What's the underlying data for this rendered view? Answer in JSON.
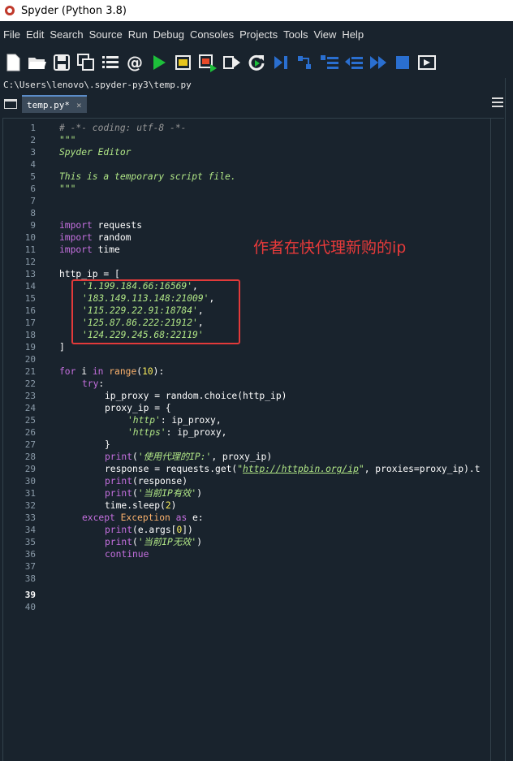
{
  "window": {
    "title": "Spyder (Python 3.8)"
  },
  "menu": [
    "File",
    "Edit",
    "Search",
    "Source",
    "Run",
    "Debug",
    "Consoles",
    "Projects",
    "Tools",
    "View",
    "Help"
  ],
  "toolbar_icons": [
    "new-file-icon",
    "open-folder-icon",
    "save-icon",
    "save-all-icon",
    "outline-icon",
    "at-icon",
    "run-icon",
    "run-cell-icon",
    "run-cell-advance-icon",
    "run-selection-icon",
    "re-run-icon",
    "debug-icon",
    "step-icon",
    "step-into-icon",
    "step-return-icon",
    "continue-icon",
    "stop-icon",
    "maximize-pane-icon"
  ],
  "path": "C:\\Users\\lenovo\\.spyder-py3\\temp.py",
  "tab": {
    "label": "temp.py*",
    "close": "×"
  },
  "line_numbers": [
    "1",
    "2",
    "3",
    "4",
    "5",
    "6",
    "7",
    "8",
    "9",
    "10",
    "11",
    "12",
    "13",
    "14",
    "15",
    "16",
    "17",
    "18",
    "19",
    "20",
    "21",
    "22",
    "23",
    "24",
    "25",
    "26",
    "27",
    "28",
    "29",
    "30",
    "31",
    "32",
    "33",
    "34",
    "35",
    "36",
    "37",
    "38",
    "39",
    "40"
  ],
  "current_line": 39,
  "annotation": "作者在快代理新购的ip",
  "code": {
    "l1": "# -*- coding: utf-8 -*-",
    "l2": "\"\"\"",
    "l3": "Spyder Editor",
    "l5": "This is a temporary script file.",
    "l6": "\"\"\"",
    "l9_kw": "import",
    "l9_rest": " requests",
    "l10_kw": "import",
    "l10_rest": " random",
    "l11_kw": "import",
    "l11_rest": " time",
    "l13": "http_ip = [",
    "l14": "'1.199.184.66:16569'",
    "l14_tail": ",",
    "l15": "'183.149.113.148:21009'",
    "l15_tail": ",",
    "l16": "'115.229.22.91:18784'",
    "l16_tail": ",",
    "l17": "'125.87.86.222:21912'",
    "l17_tail": ",",
    "l18": "'124.229.245.68:22119'",
    "l19": "]",
    "l21_for": "for",
    "l21_a": " i ",
    "l21_in": "in",
    "l21_sp": " ",
    "l21_range": "range",
    "l21_p1": "(",
    "l21_num": "10",
    "l21_p2": "):",
    "l22": "try",
    "l22_tail": ":",
    "l23": "ip_proxy = random.choice(http_ip)",
    "l24": "proxy_ip = {",
    "l25_s": "'http'",
    "l25_rest": ": ip_proxy,",
    "l26_s": "'https'",
    "l26_rest": ": ip_proxy,",
    "l27": "}",
    "l28_print": "print",
    "l28_p": "(",
    "l28_s": "'使用代理的IP:'",
    "l28_rest": ", proxy_ip)",
    "l29_a": "response = requests.get(",
    "l29_q1": "\"",
    "l29_url": "http://httpbin.org/ip",
    "l29_q2": "\"",
    "l29_rest": ", proxies=proxy_ip).t",
    "l30_print": "print",
    "l30_rest": "(response)",
    "l31_print": "print",
    "l31_p": "(",
    "l31_s": "'当前IP有效'",
    "l31_rest": ")",
    "l32_a": "time.sleep(",
    "l32_num": "2",
    "l32_b": ")",
    "l33_except": "except",
    "l33_exc": " Exception ",
    "l33_as": "as",
    "l33_rest": " e:",
    "l34_print": "print",
    "l34_a": "(e.args[",
    "l34_num": "0",
    "l34_b": "])",
    "l35_print": "print",
    "l35_p": "(",
    "l35_s": "'当前IP无效'",
    "l35_rest": ")",
    "l36": "continue"
  }
}
